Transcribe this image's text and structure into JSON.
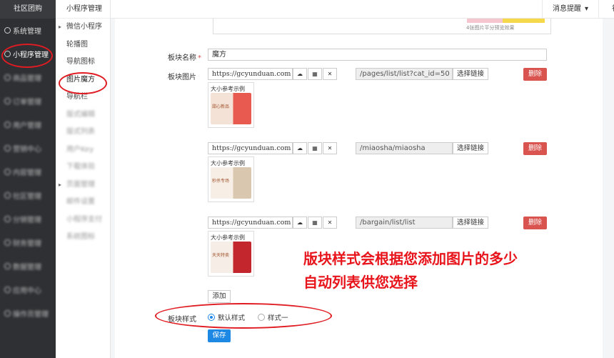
{
  "sidebar": {
    "brand": "社区团购",
    "items": [
      {
        "label": "系统管理",
        "blur": false
      },
      {
        "label": "小程序管理",
        "blur": false
      },
      {
        "label": "商品管理",
        "blur": true
      },
      {
        "label": "订单管理",
        "blur": true
      },
      {
        "label": "用户管理",
        "blur": true
      },
      {
        "label": "营销中心",
        "blur": true
      },
      {
        "label": "内容管理",
        "blur": true
      },
      {
        "label": "社区管理",
        "blur": true
      },
      {
        "label": "分销管理",
        "blur": true
      },
      {
        "label": "财务管理",
        "blur": true
      },
      {
        "label": "数据管理",
        "blur": true
      },
      {
        "label": "应用中心",
        "blur": true
      },
      {
        "label": "操作员管理",
        "blur": true
      }
    ]
  },
  "subnav": {
    "title": "小程序管理",
    "items": [
      {
        "label": "微信小程序",
        "arrow": true,
        "blur": false
      },
      {
        "label": "轮播图",
        "arrow": false,
        "blur": false
      },
      {
        "label": "导航图标",
        "arrow": false,
        "blur": false
      },
      {
        "label": "图片魔方",
        "arrow": false,
        "blur": false
      },
      {
        "label": "导航栏",
        "arrow": false,
        "blur": false
      },
      {
        "label": "版式编辑",
        "arrow": false,
        "blur": true
      },
      {
        "label": "版式列表",
        "arrow": false,
        "blur": true
      },
      {
        "label": "用户Key",
        "arrow": false,
        "blur": true
      },
      {
        "label": "下载体验",
        "arrow": false,
        "blur": true
      },
      {
        "label": "页面管理",
        "arrow": true,
        "blur": true
      },
      {
        "label": "邮件设置",
        "arrow": false,
        "blur": true
      },
      {
        "label": "小程序支付",
        "arrow": false,
        "blur": true
      },
      {
        "label": "系统图标",
        "arrow": false,
        "blur": true
      }
    ]
  },
  "topbar": {
    "messages": "消息提醒",
    "extra": "社"
  },
  "preview_note": "4张图片平分预览效果",
  "form": {
    "name_label": "板块名称",
    "required_mark": "*",
    "name_value": "魔方",
    "image_label": "板块图片",
    "style_label": "板块样式",
    "rows": [
      {
        "url": "https://gcyunduan.com",
        "link": "/pages/list/list?cat_id=50",
        "thumb_title": "大小参考示例",
        "thumb_sub": "甜心新品"
      },
      {
        "url": "https://gcyunduan.com",
        "link": "/miaosha/miaosha",
        "thumb_title": "大小参考示例",
        "thumb_sub": "秒杀专场"
      },
      {
        "url": "https://gcyunduan.com",
        "link": "/bargain/list/list",
        "thumb_title": "大小参考示例",
        "thumb_sub": "天天特卖"
      }
    ],
    "choose_link": "选择链接",
    "delete": "删除",
    "add": "添加",
    "style_options": [
      "默认样式",
      "样式一"
    ],
    "save": "保存"
  },
  "annotation": {
    "line1": "版块样式会根据您添加图片的多少",
    "line2": "自动列表供您选择",
    "color": "#e8141b"
  }
}
